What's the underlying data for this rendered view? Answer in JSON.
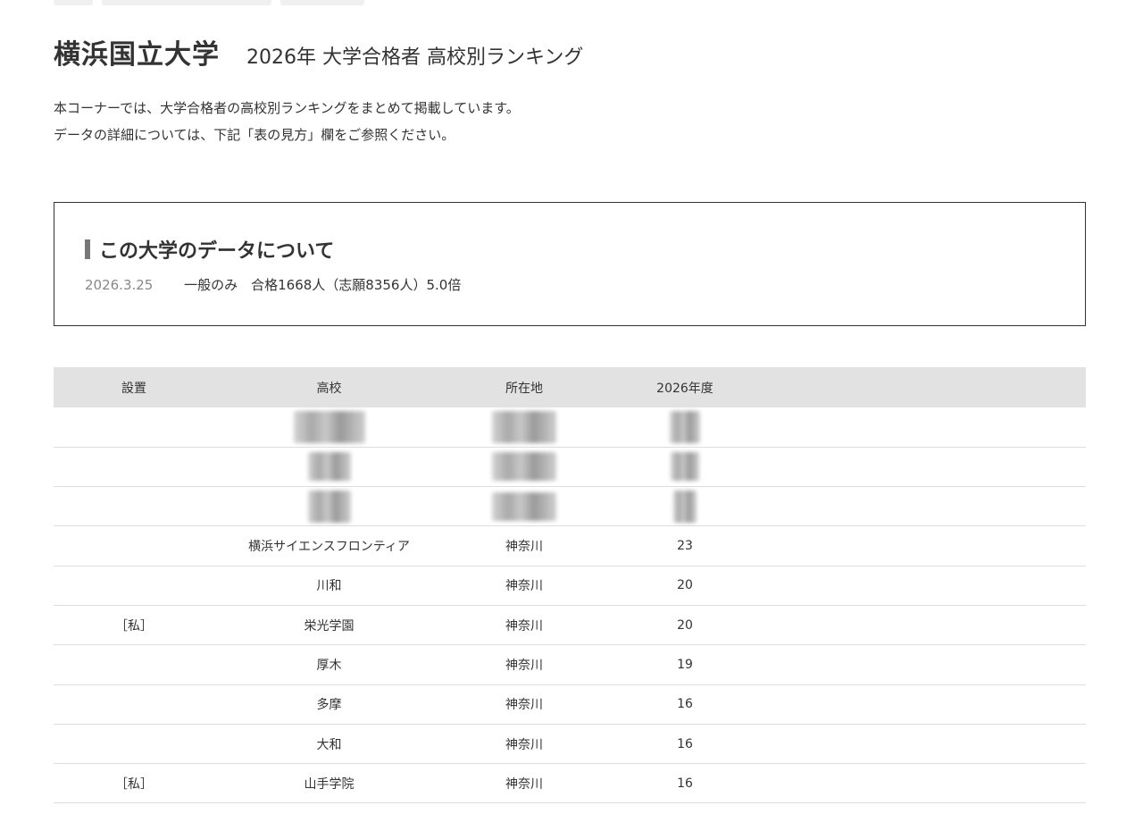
{
  "header": {
    "university": "横浜国立大学",
    "subtitle": "2026年 大学合格者 高校別ランキング"
  },
  "intro": {
    "line1": "本コーナーでは、大学合格者の高校別ランキングをまとめて掲載しています。",
    "line2": "データの詳細については、下記「表の見方」欄をご参照ください。"
  },
  "info": {
    "title": "この大学のデータについて",
    "date": "2026.3.25",
    "summary": "一般のみ　合格1668人（志願8356人）5.0倍"
  },
  "table": {
    "headers": [
      "設置",
      "高校",
      "所在地",
      "2026年度"
    ],
    "rows": [
      {
        "setchi": "",
        "school": "",
        "location": "",
        "count": "",
        "blurred": true
      },
      {
        "setchi": "",
        "school": "",
        "location": "",
        "count": "",
        "blurred": true
      },
      {
        "setchi": "",
        "school": "",
        "location": "",
        "count": "",
        "blurred": true
      },
      {
        "setchi": "",
        "school": "横浜サイエンスフロンティア",
        "location": "神奈川",
        "count": "23"
      },
      {
        "setchi": "",
        "school": "川和",
        "location": "神奈川",
        "count": "20"
      },
      {
        "setchi": "［私］",
        "school": "栄光学園",
        "location": "神奈川",
        "count": "20"
      },
      {
        "setchi": "",
        "school": "厚木",
        "location": "神奈川",
        "count": "19"
      },
      {
        "setchi": "",
        "school": "多摩",
        "location": "神奈川",
        "count": "16"
      },
      {
        "setchi": "",
        "school": "大和",
        "location": "神奈川",
        "count": "16"
      },
      {
        "setchi": "［私］",
        "school": "山手学院",
        "location": "神奈川",
        "count": "16"
      }
    ]
  },
  "colors": {
    "text": "#333333",
    "header_bg": "#e2e2e2",
    "row_border": "#dddddd",
    "accent_bar": "#777777",
    "date_gray": "#888888"
  }
}
